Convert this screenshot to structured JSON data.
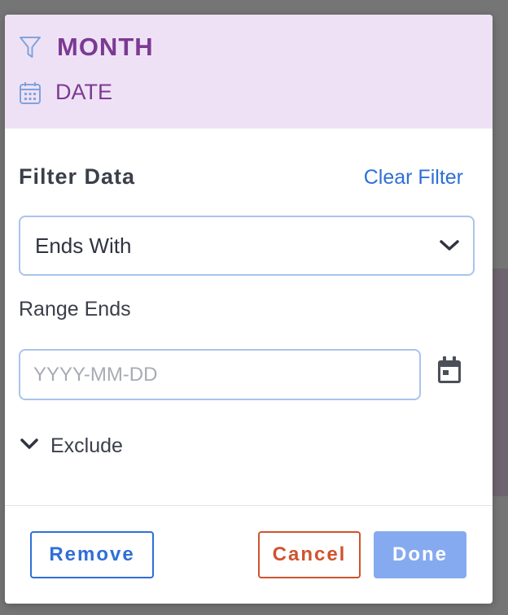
{
  "header": {
    "field_name": "MONTH",
    "field_type": "DATE",
    "filter_icon": "funnel-icon",
    "type_icon": "calendar-icon",
    "background": "#efe1f5",
    "accent": "#7b3a93"
  },
  "filter": {
    "title": "Filter Data",
    "clear_label": "Clear Filter",
    "operator": {
      "selected": "Ends With",
      "icon": "chevron-down-icon"
    },
    "range_label": "Range Ends",
    "date_input": {
      "value": "",
      "placeholder": "YYYY-MM-DD"
    },
    "calendar_icon": "calendar-icon",
    "exclude": {
      "label": "Exclude",
      "icon": "chevron-down-icon"
    }
  },
  "footer": {
    "remove_label": "Remove",
    "cancel_label": "Cancel",
    "done_label": "Done",
    "colors": {
      "remove": "#2f6fd6",
      "cancel": "#d0532e",
      "done": "#86aaf0"
    }
  }
}
